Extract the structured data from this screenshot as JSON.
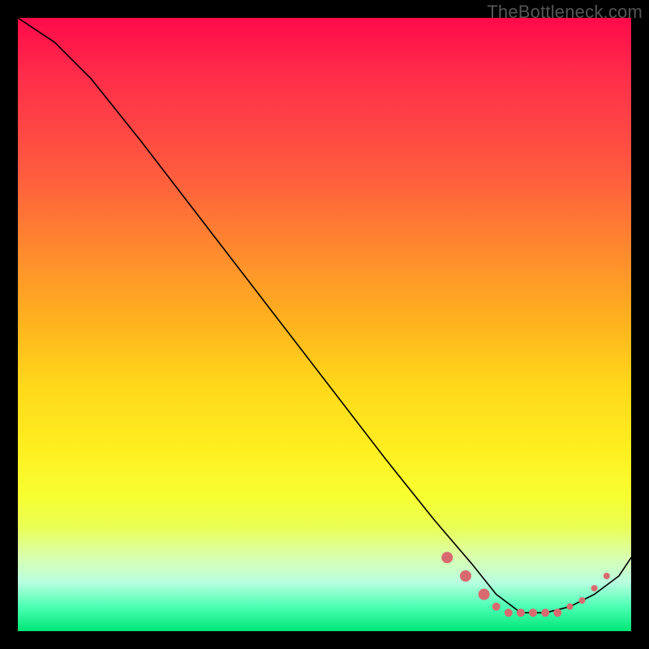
{
  "watermark": "TheBottleneck.com",
  "chart_data": {
    "type": "line",
    "title": "",
    "xlabel": "",
    "ylabel": "",
    "xlim": [
      0,
      100
    ],
    "ylim": [
      0,
      100
    ],
    "grid": false,
    "background_gradient": [
      "#ff0a4a",
      "#ffee20",
      "#00e676"
    ],
    "series": [
      {
        "name": "curve",
        "x": [
          0,
          6,
          12,
          20,
          30,
          40,
          50,
          60,
          68,
          74,
          78,
          82,
          86,
          90,
          94,
          98,
          100
        ],
        "y": [
          100,
          96,
          90,
          80,
          67,
          54,
          41,
          28,
          18,
          11,
          6,
          3,
          3,
          4,
          6,
          9,
          12
        ]
      }
    ],
    "points": [
      {
        "name": "cluster-left-edge",
        "x": 70,
        "y": 12,
        "size": "big"
      },
      {
        "name": "cluster-a",
        "x": 73,
        "y": 9,
        "size": "big"
      },
      {
        "name": "cluster-b",
        "x": 76,
        "y": 6,
        "size": "big"
      },
      {
        "name": "cluster-c",
        "x": 78,
        "y": 4,
        "size": "mid"
      },
      {
        "name": "cluster-d",
        "x": 80,
        "y": 3,
        "size": "mid"
      },
      {
        "name": "cluster-e",
        "x": 82,
        "y": 3,
        "size": "mid"
      },
      {
        "name": "cluster-f",
        "x": 84,
        "y": 3,
        "size": "mid"
      },
      {
        "name": "cluster-g",
        "x": 86,
        "y": 3,
        "size": "mid"
      },
      {
        "name": "cluster-h",
        "x": 88,
        "y": 3,
        "size": "mid"
      },
      {
        "name": "cluster-i",
        "x": 90,
        "y": 4,
        "size": "sml"
      },
      {
        "name": "cluster-j",
        "x": 92,
        "y": 5,
        "size": "sml"
      },
      {
        "name": "upper-right-a",
        "x": 94,
        "y": 7,
        "size": "sml"
      },
      {
        "name": "upper-right-b",
        "x": 96,
        "y": 9,
        "size": "sml"
      }
    ]
  }
}
